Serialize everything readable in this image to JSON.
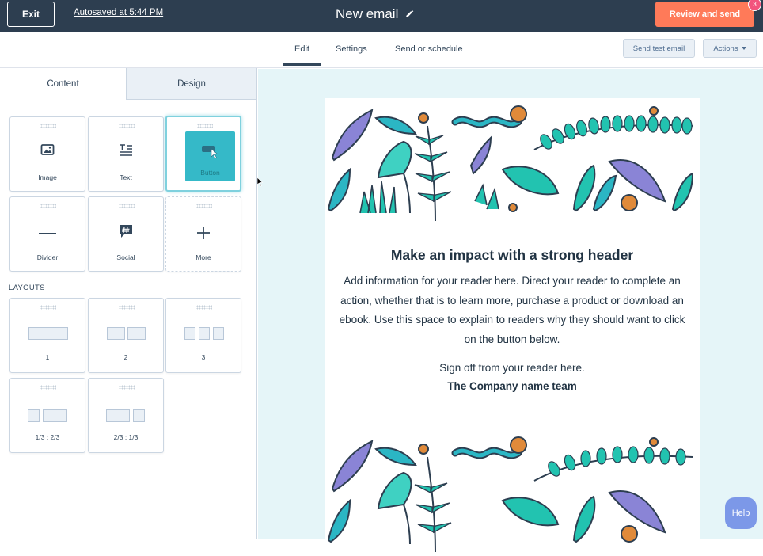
{
  "topbar": {
    "exit_label": "Exit",
    "autosave_text": "Autosaved at 5:44 PM",
    "email_title": "New email",
    "review_label": "Review and send",
    "notification_count": "3"
  },
  "subnav": {
    "tabs": [
      {
        "label": "Edit",
        "active": true
      },
      {
        "label": "Settings",
        "active": false
      },
      {
        "label": "Send or schedule",
        "active": false
      }
    ],
    "send_test_label": "Send test email",
    "actions_label": "Actions"
  },
  "panel": {
    "tabs": [
      {
        "label": "Content",
        "active": true
      },
      {
        "label": "Design",
        "active": false
      }
    ],
    "modules": [
      {
        "label": "Image",
        "icon": "image-icon"
      },
      {
        "label": "Text",
        "icon": "text-icon"
      },
      {
        "label": "Button",
        "icon": "button-icon",
        "selected": true
      },
      {
        "label": "Divider",
        "icon": "divider-icon"
      },
      {
        "label": "Social",
        "icon": "social-icon"
      },
      {
        "label": "More",
        "icon": "plus-icon"
      }
    ],
    "layouts_title": "LAYOUTS",
    "layouts": [
      {
        "label": "1"
      },
      {
        "label": "2"
      },
      {
        "label": "3"
      },
      {
        "label": "1/3 : 2/3"
      },
      {
        "label": "2/3 : 1/3"
      }
    ]
  },
  "email": {
    "heading": "Make an impact with a strong header",
    "paragraph": "Add information for your reader here. Direct your reader to complete an action, whether that is to learn more, purchase a product or download an ebook. Use this space to explain to readers why they should want to click on the button below.",
    "signoff": "Sign off from your reader here.",
    "company": "The Company name team"
  },
  "help_label": "Help",
  "colors": {
    "topbar": "#2d3e50",
    "accent_orange": "#ff7a59",
    "canvas_bg": "#e5f5f8",
    "teal": "#22c3b0",
    "purple": "#8a84d6",
    "orange_dot": "#e08a3a"
  }
}
